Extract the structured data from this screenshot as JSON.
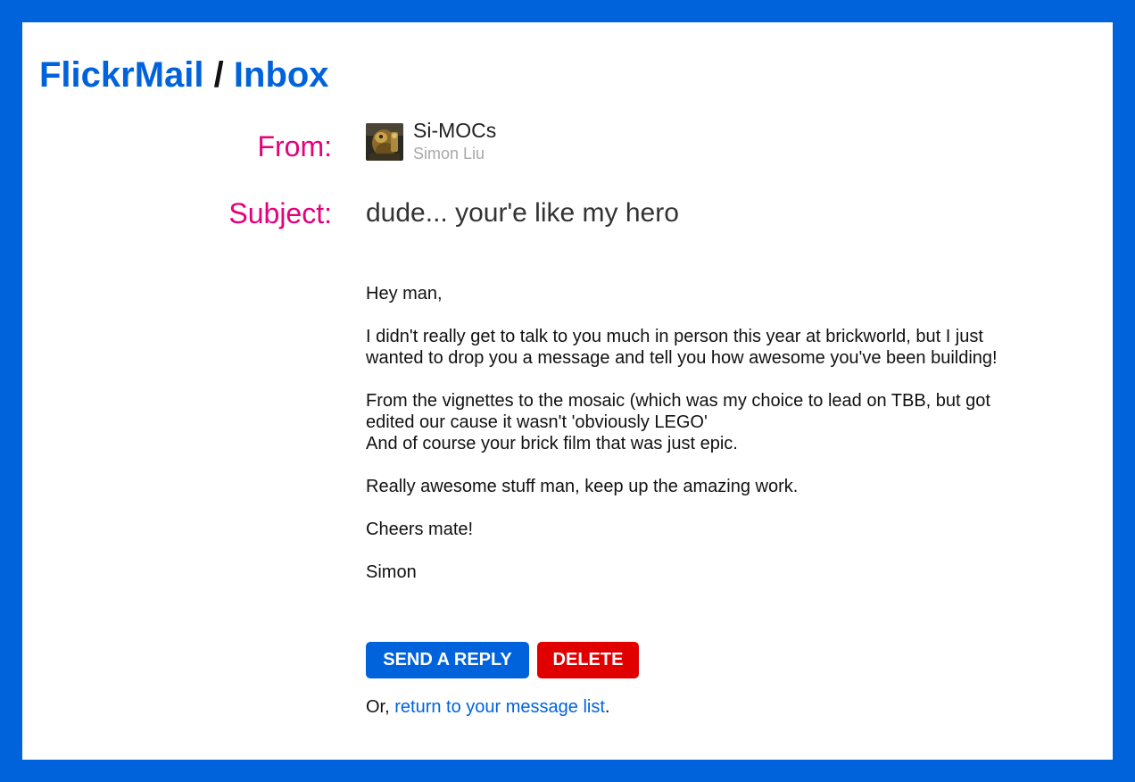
{
  "breadcrumb": {
    "app": "FlickrMail",
    "separator": "/",
    "section": "Inbox"
  },
  "message": {
    "from_label": "From:",
    "subject_label": "Subject:",
    "sender": {
      "screen_name": "Si-MOCs",
      "real_name": "Simon Liu",
      "avatar_icon": "lego-minifig-avatar"
    },
    "subject": "dude... your'e like my hero",
    "body": {
      "p1": "Hey man,",
      "p2": "I didn't really get to talk to you much in person this year at brickworld, but I just wanted to drop you a message and tell you how awesome you've been building!",
      "p3_line1": "From the vignettes to the mosaic (which was my choice to lead on TBB, but got edited our cause it wasn't 'obviously LEGO'",
      "p3_line2": "And of course your brick film that was just epic.",
      "p4": "Really awesome stuff man, keep up the amazing work.",
      "p5": "Cheers mate!",
      "p6": "Simon"
    }
  },
  "actions": {
    "reply_label": "SEND A REPLY",
    "delete_label": "DELETE",
    "return_prefix": "Or, ",
    "return_link": "return to your message list",
    "return_suffix": "."
  },
  "colors": {
    "brand_blue": "#0063dc",
    "label_pink": "#e6007a",
    "delete_red": "#e00000"
  }
}
